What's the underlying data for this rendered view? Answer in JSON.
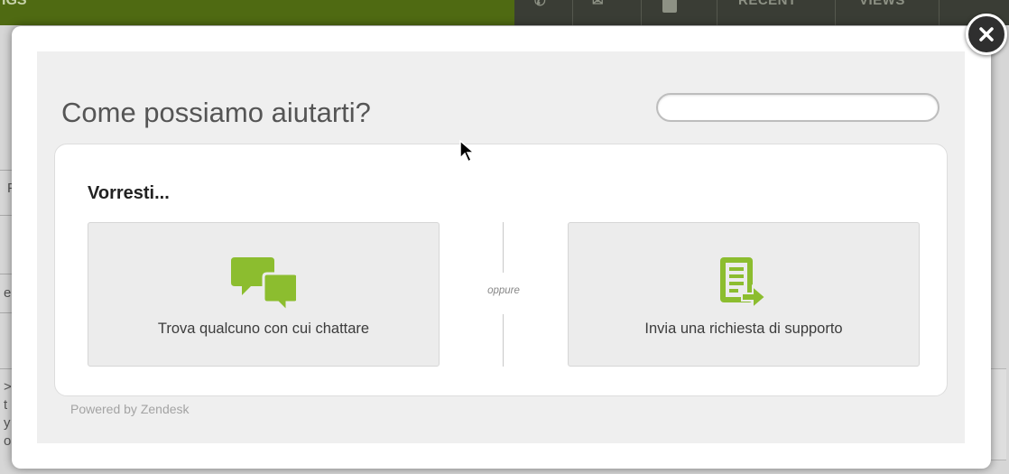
{
  "background": {
    "brand_fragment": "IGS",
    "nav_items": [
      "RECENT",
      "VIEWS"
    ],
    "side_fragments": [
      "F",
      "e",
      ">",
      "t",
      "y",
      "o."
    ]
  },
  "modal": {
    "title": "Come possiamo aiutarti?",
    "search_placeholder": "",
    "heading": "Vorresti...",
    "options": [
      {
        "label": "Trova qualcuno con cui chattare",
        "icon": "chat-bubbles-icon"
      },
      {
        "label": "Invia una richiesta di supporto",
        "icon": "document-arrow-icon"
      }
    ],
    "divider": "oppure",
    "powered_by": "Powered by Zendesk",
    "close_icon": "close-icon"
  },
  "colors": {
    "accent_green": "#8cbd2f",
    "topbar_green": "#4f6a12",
    "nav_dark": "#3a3d35"
  }
}
